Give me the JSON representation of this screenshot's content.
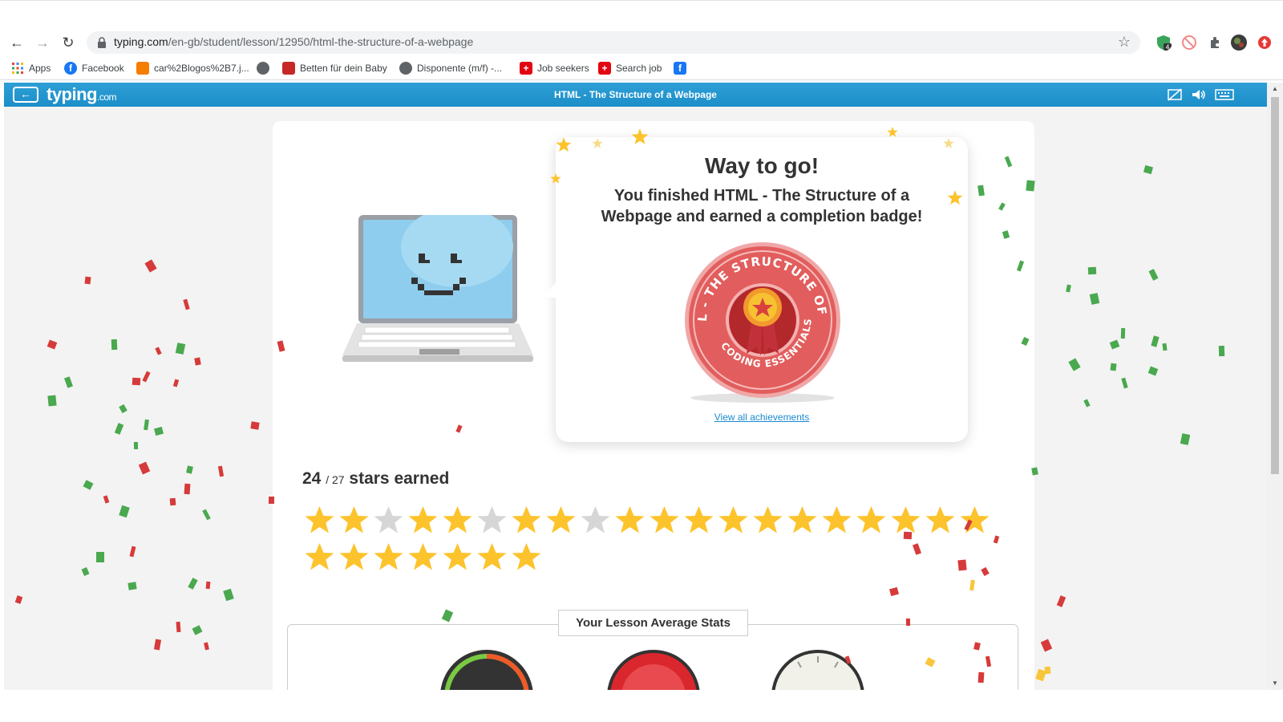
{
  "browser": {
    "url_host": "typing.com",
    "url_path": "/en-gb/student/lesson/12950/html-the-structure-of-a-webpage",
    "bookmarks": [
      {
        "label": "Apps",
        "icon": "apps-grid-icon"
      },
      {
        "label": "Facebook",
        "icon": "facebook-icon"
      },
      {
        "label": "car%2Blogos%2B7.j...",
        "icon": "blogger-icon"
      },
      {
        "label": "",
        "icon": "globe-icon"
      },
      {
        "label": "Betten für dein Baby",
        "icon": "shop-icon"
      },
      {
        "label": "Disponente (m/f) -...",
        "icon": "globe-icon"
      },
      {
        "label": "Job seekers",
        "icon": "swiss-shield-icon"
      },
      {
        "label": "Search job",
        "icon": "swiss-shield-icon"
      },
      {
        "label": "",
        "icon": "facebook-square-icon"
      }
    ],
    "extension_badge": "4"
  },
  "app": {
    "logo_main": "typing",
    "logo_suffix": ".com",
    "lesson_title": "HTML - The Structure of a Webpage"
  },
  "completion": {
    "heading": "Way to go!",
    "message": "You finished HTML - The Structure of a Webpage and earned a completion badge!",
    "badge_ring_text": "L - THE STRUCTURE OF A WEBP",
    "badge_bottom_text": "CODING ESSENTIALS",
    "achievements_link": "View all achievements"
  },
  "stars": {
    "earned": "24",
    "total": "/ 27",
    "label": "stars earned",
    "states": [
      1,
      1,
      0,
      1,
      1,
      0,
      1,
      1,
      0,
      1,
      1,
      1,
      1,
      1,
      1,
      1,
      1,
      1,
      1,
      1,
      1,
      1,
      1,
      1,
      1,
      1,
      1
    ]
  },
  "stats": {
    "title": "Your Lesson Average Stats"
  },
  "colors": {
    "app_bar": "#1c8ec8",
    "star_on": "#fcc32c",
    "star_off": "#d6d6d6",
    "badge_red": "#e25d5d",
    "confetti_red": "#d63a3a",
    "confetti_green": "#4aa84f"
  }
}
